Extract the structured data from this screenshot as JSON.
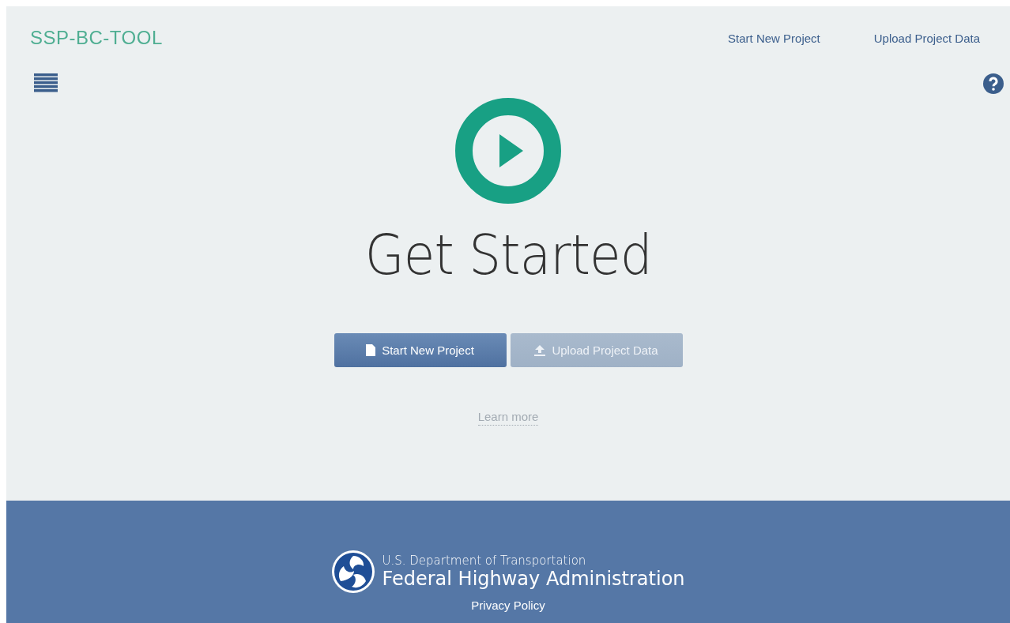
{
  "header": {
    "brand": "SSP-BC-TOOL",
    "nav": [
      "Start New Project",
      "Upload Project Data"
    ]
  },
  "hero": {
    "title": "Get Started",
    "buttons": [
      {
        "label": "Start New Project",
        "kind": "file",
        "disabled": false
      },
      {
        "label": "Upload Project Data",
        "kind": "upload",
        "disabled": true
      }
    ],
    "link": "Learn more"
  },
  "footer": {
    "agency_line": "U.S. Department of Transportation",
    "agency_name": "Federal Highway Administration",
    "link": "Privacy Policy"
  }
}
